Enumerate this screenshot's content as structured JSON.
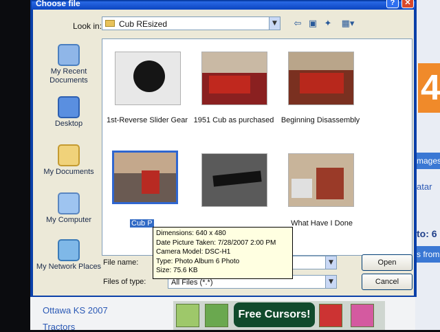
{
  "dialog": {
    "title": "Choose file",
    "help_glyph": "?",
    "close_glyph": "✕",
    "look_in_label": "Look in:",
    "look_in_value": "Cub REsized",
    "places": [
      {
        "label": "My Recent Documents",
        "icon": "recent-documents-icon"
      },
      {
        "label": "Desktop",
        "icon": "desktop-icon"
      },
      {
        "label": "My Documents",
        "icon": "my-documents-icon"
      },
      {
        "label": "My Computer",
        "icon": "my-computer-icon"
      },
      {
        "label": "My Network Places",
        "icon": "network-places-icon"
      }
    ],
    "files": [
      {
        "caption": "1st-Reverse Slider Gear"
      },
      {
        "caption": "1951 Cub as purchased"
      },
      {
        "caption": "Beginning Disassembly"
      },
      {
        "caption": "Cub P"
      },
      {
        "caption": ""
      },
      {
        "caption": "What Have I Done"
      }
    ],
    "tooltip": {
      "dimensions": "Dimensions: 640 x 480",
      "date_taken": "Date Picture Taken: 7/28/2007 2:00 PM",
      "camera": "Camera Model: DSC-H1",
      "type": "Type: Photo Album 6 Photo",
      "size": "Size: 75.6 KB"
    },
    "file_name_label": "File name:",
    "file_name_value": "",
    "files_of_type_label": "Files of type:",
    "files_of_type_value": "All Files (*.*)",
    "open_label": "Open",
    "cancel_label": "Cancel"
  },
  "background": {
    "orange_glyph": "4",
    "strip1": "mages",
    "strip2": "atar",
    "side_to": "to: 6",
    "strip3": "s from",
    "link1": "Ottawa KS 2007",
    "link2": "Tractors",
    "banner_text": "Free Cursors!"
  },
  "colors": {
    "titlebar": "#0b45c0",
    "selection": "#316ac5",
    "tooltip_bg": "#ffffe1"
  }
}
